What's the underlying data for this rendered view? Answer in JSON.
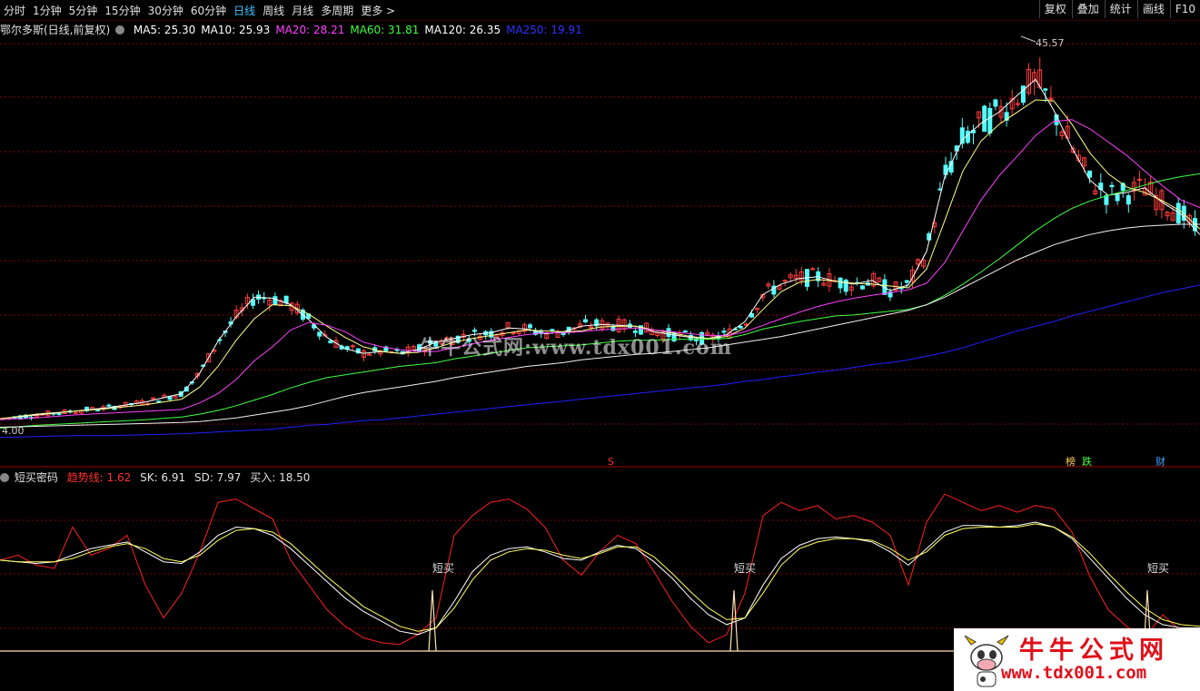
{
  "toolbar": {
    "periods": [
      "分时",
      "1分钟",
      "5分钟",
      "15分钟",
      "30分钟",
      "60分钟",
      "日线",
      "周线",
      "月线",
      "多周期",
      "更多 >"
    ],
    "active_period": "日线",
    "right_buttons": [
      "复权",
      "叠加",
      "统计",
      "画线",
      "F10"
    ]
  },
  "main_info": {
    "stock_title": "鄂尔多斯(日线,前复权)",
    "ma": [
      {
        "label": "MA5: 25.30",
        "color": "#ffffff"
      },
      {
        "label": "MA10: 25.93",
        "color": "#ffffff"
      },
      {
        "label": "MA20: 28.21",
        "color": "#ff40ff"
      },
      {
        "label": "MA60: 31.81",
        "color": "#40ff40"
      },
      {
        "label": "MA120: 26.35",
        "color": "#ffffff"
      },
      {
        "label": "MA250: 19.91",
        "color": "#3030ff"
      }
    ]
  },
  "price_annotations": {
    "high": "45.57",
    "low_partial": "4.00",
    "event_s": "S",
    "event_bang": "榜",
    "event_die": "跌",
    "event_cai": "财"
  },
  "indicator": {
    "name": "短买密码",
    "trend": "趋势线: 1.62",
    "sk": "SK: 6.91",
    "sd": "SD: 7.97",
    "buy": "买入: 18.50",
    "signal_label": "短买"
  },
  "watermark": {
    "center": "牛牛公式网:www.tdx001.com",
    "logo_title": "牛牛公式网",
    "logo_url": "www.tdx001.com"
  },
  "colors": {
    "up": "#ff3c3c",
    "down": "#54ffff",
    "grid": "#8b0000",
    "active": "#3fc3ff"
  },
  "chart_data": [
    {
      "type": "line",
      "title": "鄂尔多斯(日线,前复权)",
      "x": [
        0,
        40,
        80,
        120,
        160,
        200,
        220,
        240,
        260,
        280,
        300,
        320,
        340,
        360,
        380,
        400,
        420,
        440,
        460,
        480,
        500,
        520,
        540,
        560,
        580,
        600,
        620,
        640,
        660,
        680,
        700,
        720,
        740,
        760,
        780,
        800,
        820,
        840,
        860,
        880,
        900,
        920,
        940,
        960,
        980,
        1000,
        1020,
        1040,
        1060,
        1080,
        1100,
        1120,
        1140,
        1160,
        1180,
        1200,
        1220,
        1240,
        1260,
        1280,
        1300,
        1321
      ],
      "series": [
        {
          "name": "MA5",
          "values": [
            5.6,
            6.0,
            6.4,
            6.8,
            7.4,
            8.3,
            10.5,
            13.9,
            16.5,
            18.6,
            18.5,
            17.8,
            16.2,
            14.3,
            13.1,
            12.6,
            12.8,
            12.6,
            13.0,
            13.8,
            14.2,
            14.6,
            14.8,
            15.3,
            15.2,
            14.7,
            14.9,
            15.5,
            15.7,
            15.6,
            15.5,
            14.9,
            14.6,
            14.3,
            14.2,
            14.6,
            16.0,
            18.9,
            20.0,
            20.6,
            20.8,
            20.3,
            20.0,
            20.4,
            19.3,
            19.9,
            23.5,
            31.5,
            35.5,
            37.2,
            38.4,
            40.2,
            41.9,
            38.6,
            34.6,
            31.1,
            29.5,
            29.8,
            30.3,
            28.7,
            27.5,
            25.3
          ]
        },
        {
          "name": "MA10",
          "values": [
            5.6,
            6.1,
            6.4,
            6.7,
            7.1,
            7.7,
            9.0,
            11.2,
            14.0,
            16.3,
            17.8,
            17.7,
            16.8,
            15.5,
            14.3,
            13.3,
            12.8,
            12.6,
            12.7,
            13.2,
            13.8,
            14.2,
            14.5,
            14.8,
            15.1,
            15.0,
            14.9,
            15.0,
            15.4,
            15.5,
            15.5,
            15.1,
            14.8,
            14.4,
            14.2,
            14.4,
            15.3,
            17.3,
            19.2,
            20.2,
            20.5,
            20.3,
            20.1,
            20.0,
            19.8,
            19.6,
            21.6,
            26.8,
            32.1,
            35.3,
            37.1,
            38.4,
            39.7,
            39.6,
            37.1,
            34.0,
            31.8,
            30.4,
            29.8,
            28.9,
            27.8,
            25.9
          ]
        },
        {
          "name": "MA20",
          "values": [
            5.5,
            5.7,
            6.0,
            6.2,
            6.4,
            6.6,
            7.3,
            8.3,
            9.8,
            11.8,
            13.3,
            15.1,
            15.9,
            15.6,
            14.9,
            13.8,
            13.3,
            13.0,
            12.8,
            12.8,
            13.2,
            13.6,
            14.0,
            14.3,
            14.6,
            14.8,
            14.8,
            14.9,
            15.1,
            15.2,
            15.3,
            15.1,
            14.9,
            14.7,
            14.5,
            14.5,
            14.9,
            15.6,
            16.3,
            17.0,
            17.6,
            18.1,
            18.5,
            18.8,
            19.1,
            19.4,
            20.1,
            22.3,
            25.7,
            29.0,
            31.6,
            33.7,
            35.9,
            37.4,
            37.6,
            36.6,
            35.2,
            33.8,
            32.1,
            30.5,
            29.0,
            28.2
          ]
        },
        {
          "name": "MA60",
          "values": [
            4.6,
            4.9,
            5.1,
            5.3,
            5.5,
            5.8,
            6.1,
            6.5,
            7.0,
            7.6,
            8.2,
            8.9,
            9.5,
            10.0,
            10.3,
            10.6,
            10.9,
            11.2,
            11.4,
            11.6,
            12.0,
            12.3,
            12.6,
            12.9,
            13.2,
            13.3,
            13.4,
            13.5,
            13.7,
            13.9,
            14.0,
            14.0,
            14.1,
            14.1,
            14.1,
            14.2,
            14.6,
            15.2,
            15.6,
            16.0,
            16.3,
            16.6,
            16.7,
            16.9,
            17.1,
            17.3,
            17.8,
            18.8,
            20.0,
            21.3,
            22.7,
            24.2,
            25.7,
            27.0,
            28.1,
            28.9,
            29.5,
            30.0,
            30.6,
            31.1,
            31.5,
            31.8
          ]
        },
        {
          "name": "MA120",
          "values": [
            4.7,
            4.8,
            4.9,
            5.0,
            5.1,
            5.2,
            5.3,
            5.5,
            5.7,
            6.0,
            6.3,
            6.6,
            7.0,
            7.5,
            8.0,
            8.4,
            8.7,
            9.0,
            9.3,
            9.6,
            10.0,
            10.3,
            10.6,
            10.9,
            11.2,
            11.4,
            11.6,
            11.9,
            12.1,
            12.3,
            12.5,
            12.6,
            12.8,
            13.0,
            13.2,
            13.5,
            13.8,
            14.1,
            14.4,
            14.8,
            15.2,
            15.6,
            16.0,
            16.4,
            16.8,
            17.2,
            17.8,
            18.6,
            19.6,
            20.6,
            21.6,
            22.6,
            23.4,
            24.2,
            24.8,
            25.3,
            25.7,
            26.0,
            26.2,
            26.3,
            26.4,
            26.4
          ]
        },
        {
          "name": "MA250",
          "values": [
            3.6,
            3.7,
            3.8,
            3.8,
            3.9,
            4.0,
            4.1,
            4.2,
            4.3,
            4.4,
            4.5,
            4.7,
            4.9,
            5.0,
            5.2,
            5.4,
            5.5,
            5.7,
            5.9,
            6.1,
            6.3,
            6.5,
            6.7,
            6.9,
            7.1,
            7.3,
            7.5,
            7.7,
            7.9,
            8.1,
            8.3,
            8.5,
            8.7,
            8.9,
            9.1,
            9.3,
            9.6,
            9.8,
            10.1,
            10.3,
            10.6,
            10.8,
            11.1,
            11.4,
            11.6,
            11.9,
            12.3,
            12.7,
            13.2,
            13.8,
            14.4,
            15.0,
            15.5,
            16.0,
            16.6,
            17.1,
            17.6,
            18.1,
            18.6,
            19.1,
            19.5,
            19.9
          ]
        }
      ]
    },
    {
      "type": "line",
      "title": "短买密码",
      "x": [
        0,
        20,
        40,
        60,
        80,
        100,
        120,
        140,
        160,
        180,
        200,
        220,
        240,
        260,
        280,
        300,
        320,
        340,
        360,
        380,
        400,
        420,
        440,
        460,
        480,
        500,
        520,
        540,
        560,
        580,
        600,
        620,
        640,
        660,
        680,
        700,
        720,
        740,
        760,
        780,
        800,
        820,
        840,
        860,
        880,
        900,
        920,
        940,
        960,
        980,
        1000,
        1020,
        1040,
        1060,
        1080,
        1100,
        1120,
        1140,
        1160,
        1180,
        1200,
        1220,
        1240,
        1260,
        1280,
        1300,
        1321
      ],
      "series": [
        {
          "name": "趋势线",
          "values": [
            55,
            58,
            52,
            50,
            75,
            58,
            62,
            70,
            40,
            20,
            35,
            60,
            90,
            92,
            86,
            80,
            55,
            40,
            25,
            15,
            8,
            5,
            4,
            10,
            20,
            70,
            82,
            90,
            92,
            86,
            75,
            55,
            46,
            60,
            70,
            65,
            48,
            30,
            15,
            5,
            10,
            35,
            82,
            90,
            85,
            88,
            80,
            82,
            78,
            70,
            40,
            78,
            95,
            90,
            85,
            88,
            84,
            88,
            86,
            72,
            45,
            25,
            15,
            8,
            22,
            12,
            4
          ]
        },
        {
          "name": "SK",
          "values": [
            55,
            54,
            53,
            54,
            58,
            62,
            64,
            66,
            60,
            54,
            53,
            60,
            70,
            75,
            74,
            70,
            62,
            52,
            42,
            32,
            24,
            18,
            12,
            10,
            14,
            30,
            48,
            58,
            62,
            63,
            60,
            56,
            55,
            60,
            64,
            62,
            54,
            44,
            32,
            22,
            16,
            20,
            40,
            56,
            64,
            68,
            69,
            68,
            66,
            60,
            52,
            62,
            72,
            76,
            76,
            75,
            76,
            78,
            75,
            68,
            56,
            44,
            32,
            22,
            16,
            14,
            14
          ]
        },
        {
          "name": "SD",
          "values": [
            55,
            54,
            54,
            54,
            56,
            60,
            63,
            65,
            62,
            56,
            54,
            58,
            67,
            73,
            74,
            72,
            65,
            55,
            45,
            36,
            27,
            21,
            15,
            12,
            14,
            26,
            43,
            55,
            60,
            62,
            61,
            58,
            56,
            59,
            63,
            63,
            57,
            47,
            36,
            26,
            19,
            20,
            35,
            52,
            62,
            66,
            68,
            68,
            67,
            62,
            55,
            60,
            70,
            74,
            75,
            75,
            75,
            77,
            75,
            69,
            59,
            47,
            36,
            26,
            19,
            16,
            15
          ]
        }
      ]
    }
  ]
}
